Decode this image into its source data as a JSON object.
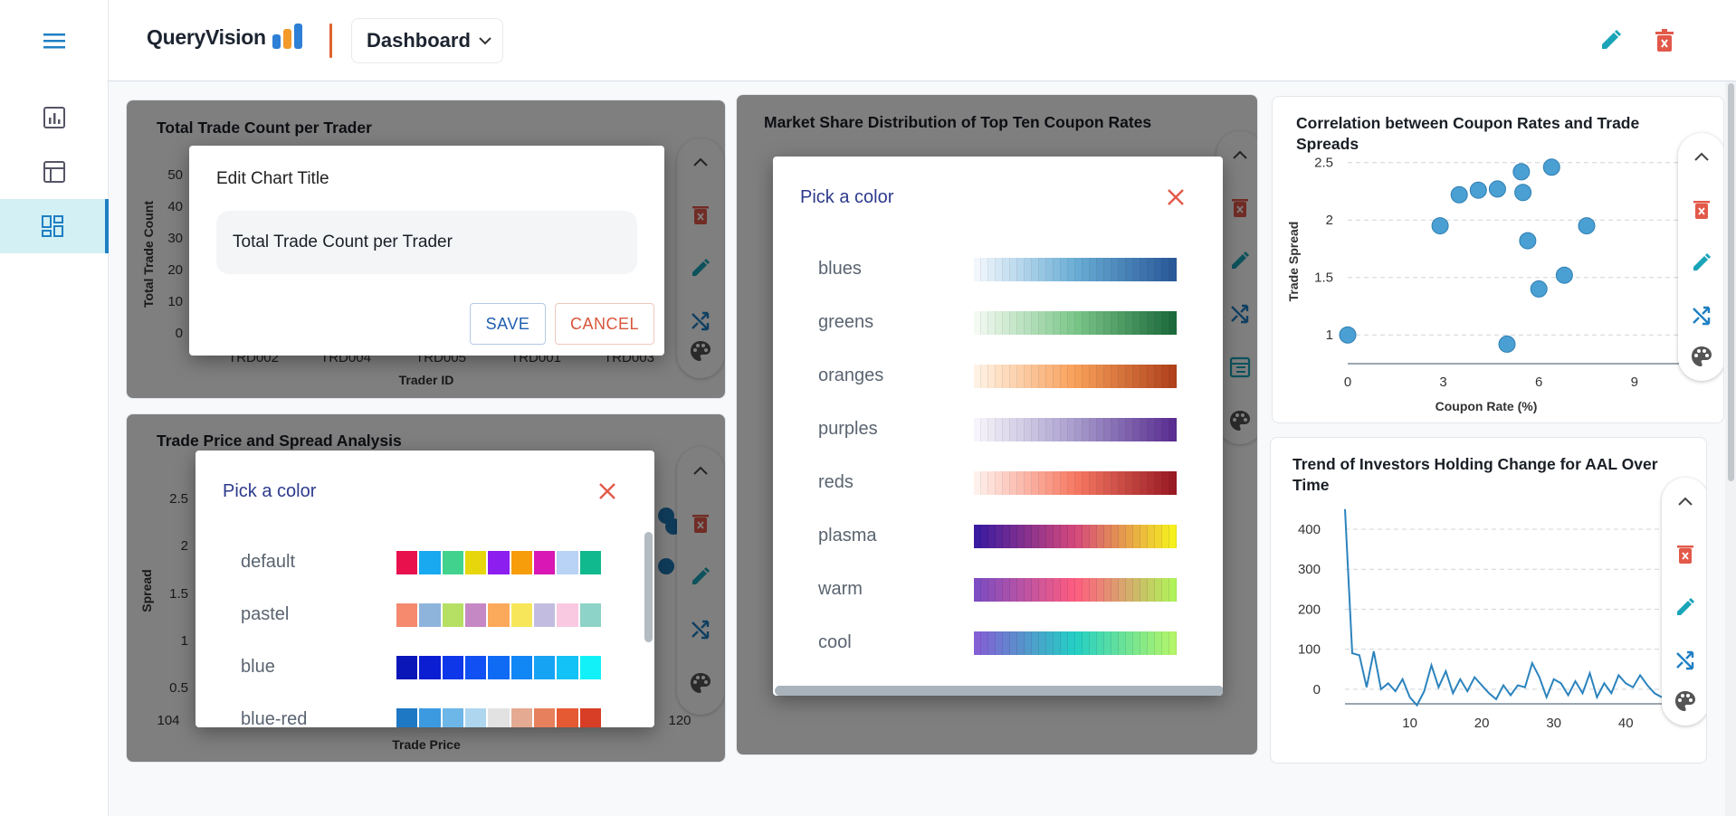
{
  "app": {
    "logo_text": "QueryVision",
    "dashboard_label": "Dashboard"
  },
  "sidebar": {
    "items": [
      {
        "icon": "menu-icon"
      },
      {
        "icon": "bar-chart-icon"
      },
      {
        "icon": "table-icon"
      },
      {
        "icon": "dashboard-icon",
        "active": true
      }
    ]
  },
  "header": {
    "edit_icon": "pencil-icon",
    "delete_icon": "trash-icon"
  },
  "charts": {
    "trade_count": {
      "title": "Total Trade Count per Trader",
      "ylabel": "Total Trade Count",
      "xlabel": "Trader ID",
      "yticks": [
        "50",
        "40",
        "30",
        "20",
        "10",
        "0"
      ],
      "xticks": [
        "TRD002",
        "TRD004",
        "TRD005",
        "TRD001",
        "TRD003"
      ]
    },
    "price_spread": {
      "title": "Trade Price and Spread Analysis",
      "ylabel": "Spread",
      "xlabel": "Trade Price",
      "yticks": [
        "2.5",
        "2",
        "1.5",
        "1",
        "0.5"
      ],
      "xticks": [
        "104",
        "120"
      ]
    },
    "market_share": {
      "title": "Market Share Distribution of Top Ten Coupon Rates"
    },
    "correlation": {
      "title": "Correlation between Coupon Rates and Trade Spreads",
      "ylabel": "Trade Spread",
      "xlabel": "Coupon Rate (%)",
      "yticks": [
        "2.5",
        "2",
        "1.5",
        "1"
      ],
      "xticks": [
        "0",
        "3",
        "6",
        "9"
      ]
    },
    "aal_trend": {
      "title": "Trend of Investors Holding Change for AAL Over Time",
      "yticks": [
        "400",
        "300",
        "200",
        "100",
        "0"
      ],
      "xticks": [
        "10",
        "20",
        "30",
        "40"
      ]
    }
  },
  "chart_data": [
    {
      "type": "scatter",
      "title": "Correlation between Coupon Rates and Trade Spreads",
      "xlabel": "Coupon Rate (%)",
      "ylabel": "Trade Spread",
      "xlim": [
        0,
        10
      ],
      "ylim": [
        0.75,
        2.6
      ],
      "grid": true,
      "points": [
        {
          "x": 0,
          "y": 1.0
        },
        {
          "x": 2.9,
          "y": 1.95
        },
        {
          "x": 3.5,
          "y": 2.22
        },
        {
          "x": 4.1,
          "y": 2.26
        },
        {
          "x": 4.7,
          "y": 2.27
        },
        {
          "x": 5.0,
          "y": 0.92
        },
        {
          "x": 5.45,
          "y": 2.42
        },
        {
          "x": 5.5,
          "y": 2.24
        },
        {
          "x": 5.65,
          "y": 1.82
        },
        {
          "x": 6.0,
          "y": 1.4
        },
        {
          "x": 6.4,
          "y": 2.46
        },
        {
          "x": 6.8,
          "y": 1.52
        },
        {
          "x": 7.5,
          "y": 1.95
        }
      ]
    },
    {
      "type": "line",
      "title": "Trend of Investors Holding Change for AAL Over Time",
      "xlim": [
        0,
        45
      ],
      "ylim": [
        -50,
        470
      ],
      "grid": true,
      "x": [
        1,
        2,
        3,
        4,
        5,
        6,
        7,
        8,
        9,
        10,
        11,
        12,
        13,
        14,
        15,
        16,
        17,
        18,
        19,
        20,
        21,
        22,
        23,
        24,
        25,
        26,
        27,
        28,
        29,
        30,
        31,
        32,
        33,
        34,
        35,
        36,
        37,
        38,
        39,
        40,
        41,
        42,
        43,
        44,
        45
      ],
      "y": [
        450,
        90,
        85,
        5,
        95,
        0,
        15,
        -5,
        25,
        -20,
        -40,
        -5,
        60,
        5,
        45,
        -10,
        25,
        -5,
        30,
        10,
        -10,
        -25,
        10,
        -15,
        10,
        5,
        65,
        30,
        -20,
        25,
        15,
        -15,
        20,
        -10,
        40,
        -20,
        15,
        -10,
        35,
        15,
        5,
        35,
        10,
        -10,
        -20
      ]
    }
  ],
  "dialogs": {
    "edit_title": {
      "heading": "Edit Chart Title",
      "value": "Total Trade Count per Trader",
      "save_label": "SAVE",
      "cancel_label": "CANCEL"
    },
    "color_picker_left": {
      "heading": "Pick a color",
      "palettes": [
        {
          "name": "default",
          "colors": [
            "#e8114e",
            "#19a9f0",
            "#41d38e",
            "#e8d60c",
            "#8c1ef0",
            "#f79c0b",
            "#d817b4",
            "#b8d3f5",
            "#11b98f"
          ]
        },
        {
          "name": "pastel",
          "colors": [
            "#f58a6f",
            "#8fb4dc",
            "#b5e063",
            "#c687c5",
            "#fba95a",
            "#f7e65a",
            "#c2bde0",
            "#f9c9e2",
            "#8dd3c7"
          ]
        },
        {
          "name": "blue",
          "colors": [
            "#0a16b8",
            "#0b1ed2",
            "#0e37ea",
            "#1150f2",
            "#0f6af4",
            "#1186f5",
            "#16a3f4",
            "#13c2f6",
            "#12f1f8"
          ]
        },
        {
          "name": "blue-red",
          "colors": [
            "#1f78c4",
            "#3c9ae0",
            "#6cb6e8",
            "#aed6ef",
            "#e2e2e2",
            "#e4aa92",
            "#e7805c",
            "#e55a33",
            "#d83d25"
          ]
        }
      ]
    },
    "color_picker_center": {
      "heading": "Pick a color",
      "palettes": [
        {
          "name": "blues",
          "from": "#f2f7fd",
          "mid": "#6aaed6",
          "to": "#2a5a9a"
        },
        {
          "name": "greens",
          "from": "#f3faf1",
          "mid": "#7cc78a",
          "to": "#1d6b3c"
        },
        {
          "name": "oranges",
          "from": "#fff2e4",
          "mid": "#f9a05a",
          "to": "#b1421c"
        },
        {
          "name": "purples",
          "from": "#f7f5fb",
          "mid": "#a89dcd",
          "to": "#5a2e92"
        },
        {
          "name": "reds",
          "from": "#fff0eb",
          "mid": "#f77a63",
          "to": "#9a1b24"
        },
        {
          "name": "plasma",
          "from": "#3a1ba0",
          "mid": "#d5487c",
          "to": "#f6f01f"
        },
        {
          "name": "warm",
          "from": "#7d4cc2",
          "mid": "#ff5c80",
          "to": "#b0f25a"
        },
        {
          "name": "cool",
          "from": "#8460d4",
          "mid": "#23cfc5",
          "to": "#b3f56a"
        }
      ]
    }
  },
  "tool_icons": [
    "chevron-up-icon",
    "trash-icon",
    "pencil-icon",
    "shuffle-icon",
    "table-icon",
    "palette-icon"
  ],
  "colors": {
    "accent": "#1f7fc3",
    "teal": "#1aa4b8",
    "delete": "#e2594a",
    "point": "#4a9fd3",
    "line": "#2b83bd"
  }
}
